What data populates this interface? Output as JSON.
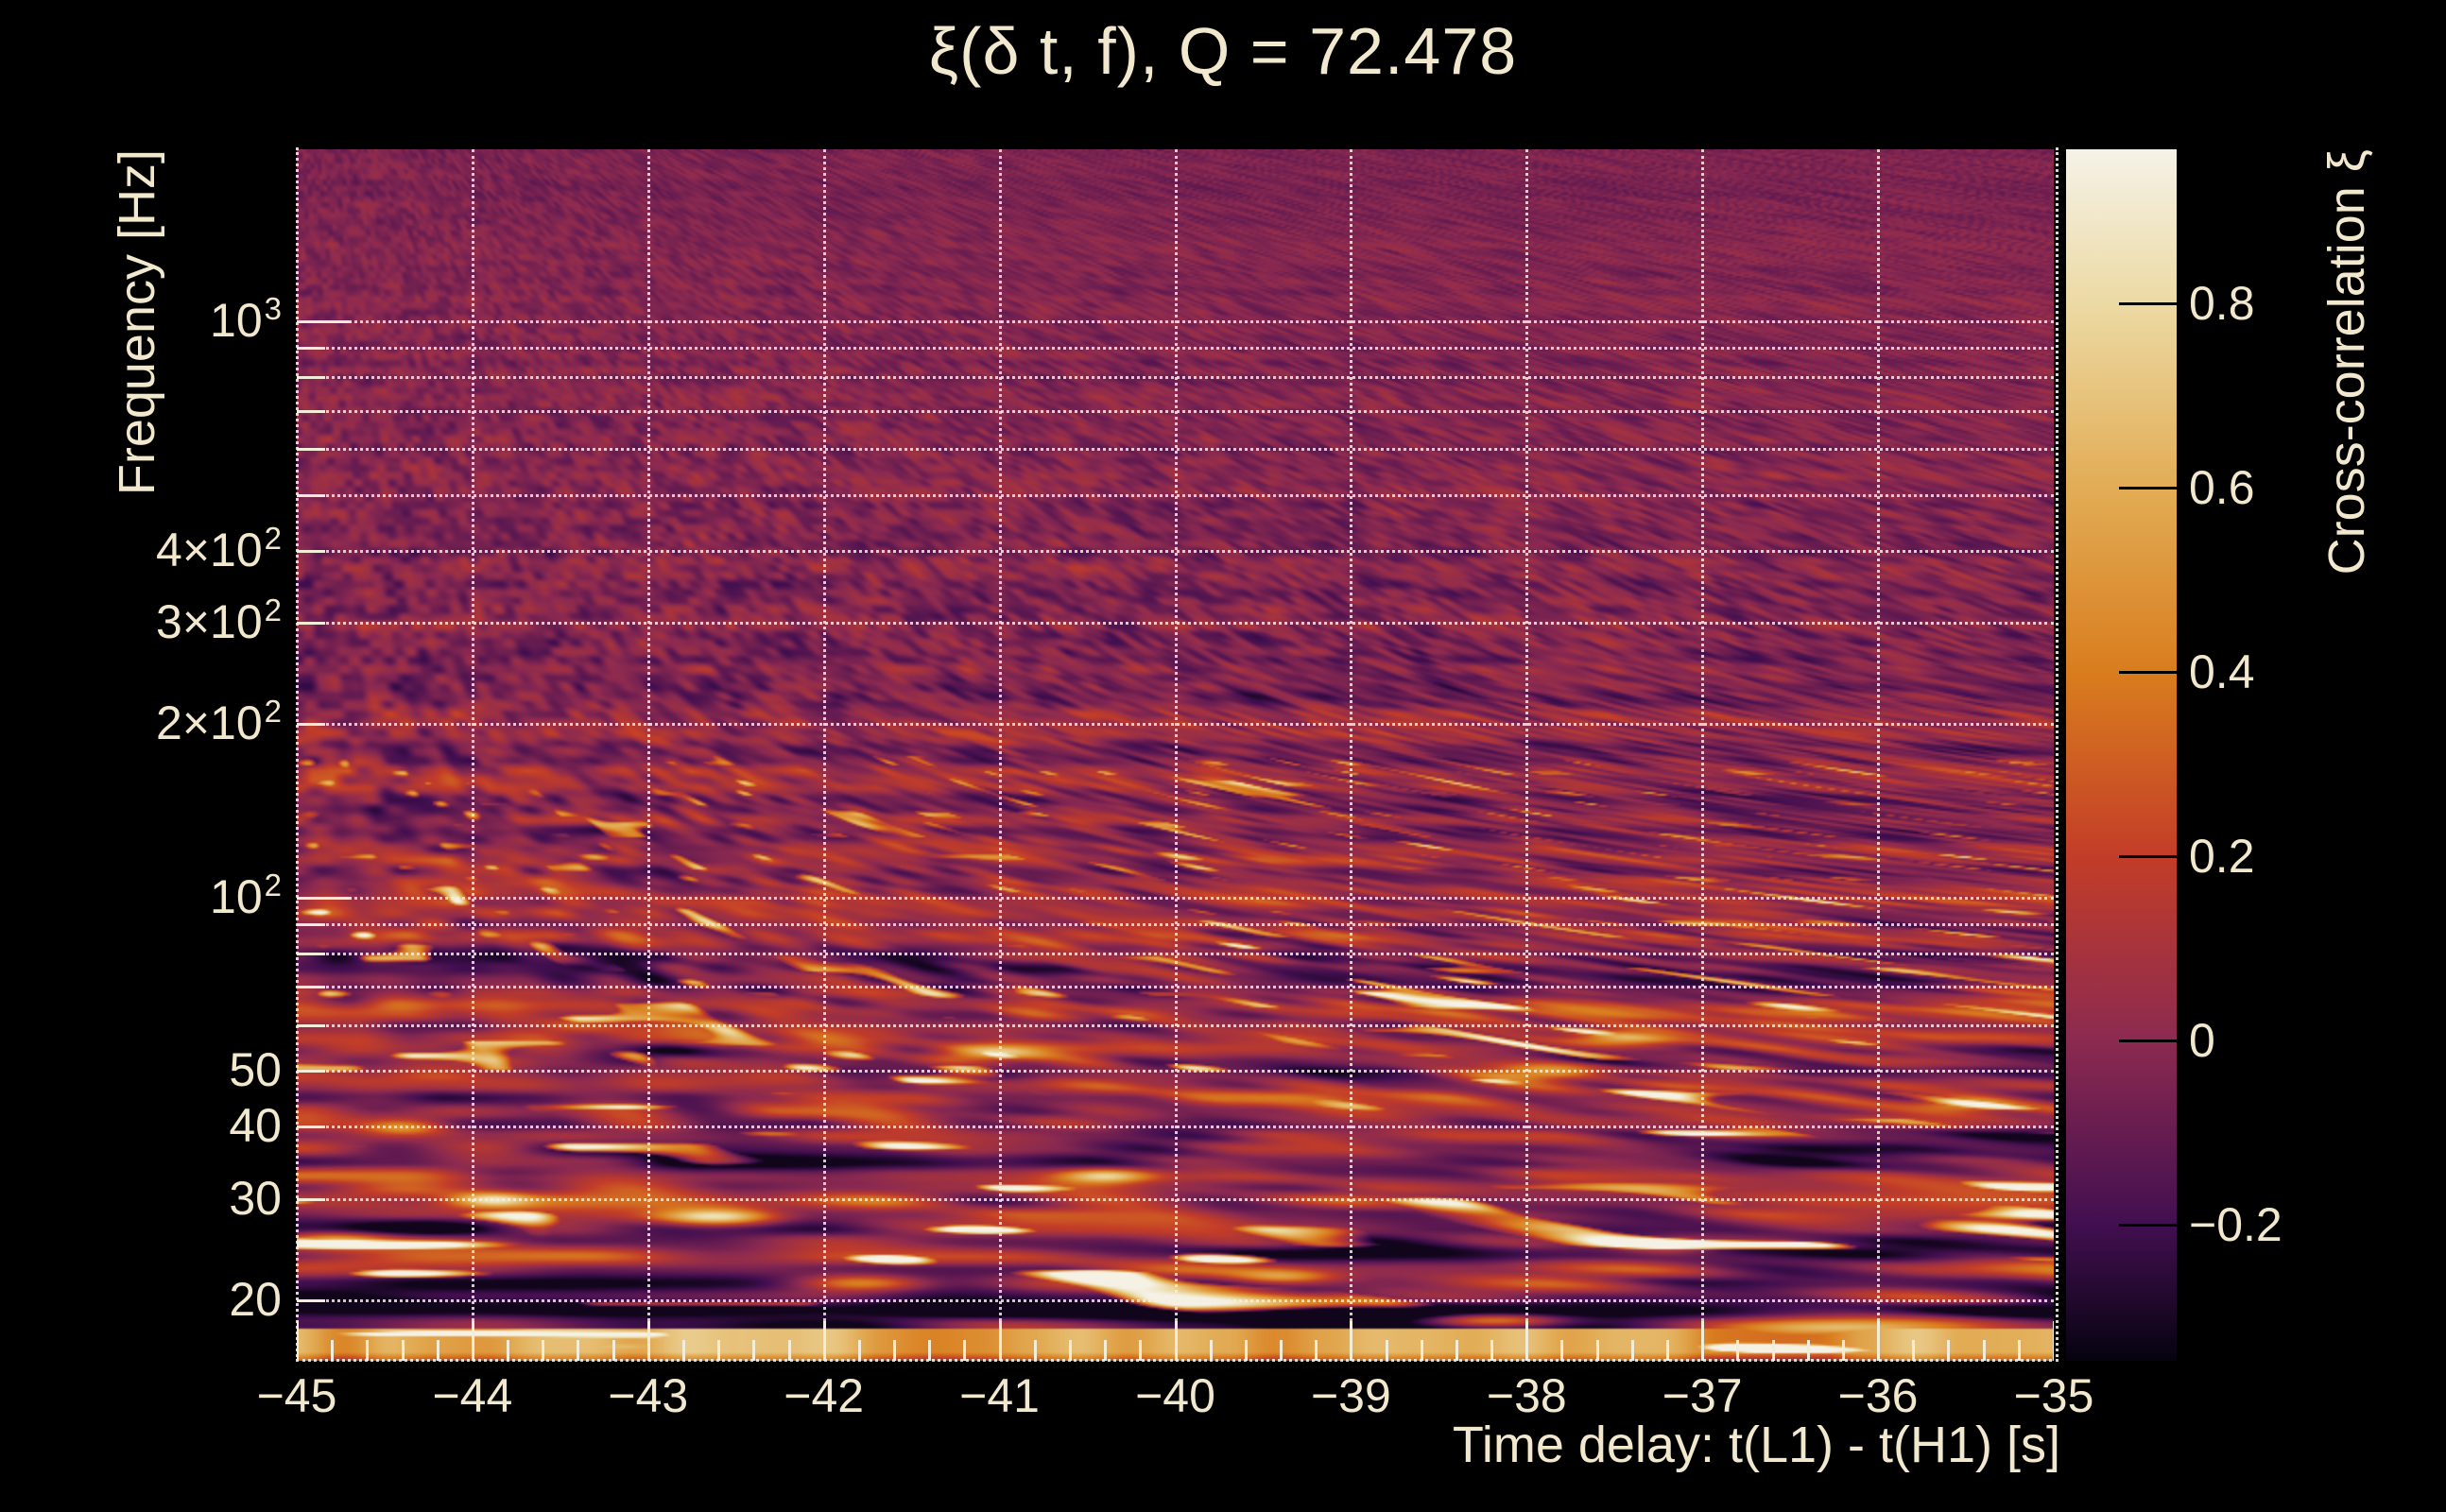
{
  "title": {
    "text": "ξ(δ t, f), Q = 72.478"
  },
  "axes": {
    "x": {
      "title": "Time delay: t(L1) - t(H1) [s]",
      "min": -45,
      "max": -35,
      "ticks": [
        {
          "label": "−45",
          "value": -45
        },
        {
          "label": "−44",
          "value": -44
        },
        {
          "label": "−43",
          "value": -43
        },
        {
          "label": "−42",
          "value": -42
        },
        {
          "label": "−41",
          "value": -41
        },
        {
          "label": "−40",
          "value": -40
        },
        {
          "label": "−39",
          "value": -39
        },
        {
          "label": "−38",
          "value": -38
        },
        {
          "label": "−37",
          "value": -37
        },
        {
          "label": "−36",
          "value": -36
        },
        {
          "label": "−35",
          "value": -35
        }
      ],
      "minor_tick_step": 0.2,
      "grid_values": [
        -44,
        -43,
        -42,
        -41,
        -40,
        -39,
        -38,
        -37,
        -36
      ]
    },
    "y": {
      "title": "Frequency [Hz]",
      "scale": "log",
      "min_hz": 15.7,
      "max_hz": 1990,
      "ticks": [
        {
          "base": "10",
          "sup": "3",
          "value": 1000
        },
        {
          "base": "4×10",
          "sup": "2",
          "value": 400
        },
        {
          "base": "3×10",
          "sup": "2",
          "value": 300
        },
        {
          "base": "2×10",
          "sup": "2",
          "value": 200
        },
        {
          "base": "10",
          "sup": "2",
          "value": 100
        },
        {
          "base": "50",
          "value": 50
        },
        {
          "base": "40",
          "value": 40
        },
        {
          "base": "30",
          "value": 30
        },
        {
          "base": "20",
          "value": 20
        }
      ],
      "grid_values": [
        1000,
        900,
        800,
        700,
        600,
        500,
        400,
        300,
        200,
        100,
        90,
        80,
        70,
        60,
        50,
        40,
        30,
        20
      ],
      "major_tick_values": [
        1000,
        100
      ]
    }
  },
  "colorbar": {
    "title": "Cross-correlation ξ",
    "vmin": -0.348,
    "vmax": 0.967,
    "ticks": [
      {
        "label": "0.8",
        "value": 0.8
      },
      {
        "label": "0.6",
        "value": 0.6
      },
      {
        "label": "0.4",
        "value": 0.4
      },
      {
        "label": "0.2",
        "value": 0.2
      },
      {
        "label": "0",
        "value": 0
      },
      {
        "label": "−0.2",
        "value": -0.2
      }
    ]
  },
  "colors": {
    "background": "#000000",
    "text": "#f2e8cd",
    "grid": "#f4eee0",
    "tick_mark": "#f3ecd8",
    "colorbar_tick": "#000000",
    "colormap_stops": [
      [
        0.0,
        "#060310"
      ],
      [
        0.113,
        "#420f50"
      ],
      [
        0.265,
        "#8c2a50"
      ],
      [
        0.417,
        "#c33d28"
      ],
      [
        0.568,
        "#d97d1e"
      ],
      [
        0.72,
        "#e2ac55"
      ],
      [
        0.873,
        "#ecdaa4"
      ],
      [
        1.0,
        "#f5f2e8"
      ]
    ]
  },
  "chart_data": {
    "type": "heatmap",
    "title": "ξ(δ t, f), Q = 72.478",
    "q_value": 72.478,
    "xlabel": "Time delay: t(L1) - t(H1) [s]",
    "ylabel": "Frequency [Hz]",
    "colorbar_label": "Cross-correlation ξ",
    "x_range_s": [
      -45,
      -35
    ],
    "y_range_hz": [
      15.7,
      1990
    ],
    "y_scale": "log",
    "color_scale_range": [
      -0.348,
      0.967
    ],
    "x_tick_values": [
      -45,
      -44,
      -43,
      -42,
      -41,
      -40,
      -39,
      -38,
      -37,
      -36,
      -35
    ],
    "y_tick_values": [
      1000,
      400,
      300,
      200,
      100,
      50,
      40,
      30,
      20
    ],
    "colorbar_tick_values": [
      0.8,
      0.6,
      0.4,
      0.2,
      0,
      -0.2
    ],
    "grid": "white dotted gridlines at 1 s intervals and at log-decade frequency steps",
    "legend_position": "right colorbar",
    "description": "Noisy cross-correlation Q-transform map: fine low-amplitude maroon mottling above ~200 Hz, horizontally elongated orange streaks below ~100 Hz growing longer toward low frequency, scattered near-white bursts between 16 and 60 Hz, and a continuous bright orange-yellow band near 16-18 Hz along the bottom.",
    "bright_features": [
      {
        "t": -44.8,
        "f": 25.5,
        "amp": 0.5,
        "rx": 60,
        "ry": 9
      },
      {
        "t": -44.4,
        "f": 40.0,
        "amp": 0.38,
        "rx": 45,
        "ry": 8
      },
      {
        "t": -43.9,
        "f": 30.0,
        "amp": 0.45,
        "rx": 40,
        "ry": 8
      },
      {
        "t": -43.3,
        "f": 16.8,
        "amp": 0.45,
        "rx": 110,
        "ry": 8
      },
      {
        "t": -42.6,
        "f": 28.0,
        "amp": 0.62,
        "rx": 60,
        "ry": 9
      },
      {
        "t": -41.9,
        "f": 16.9,
        "amp": 0.55,
        "rx": 95,
        "ry": 8
      },
      {
        "t": -41.8,
        "f": 21.5,
        "amp": 0.5,
        "rx": 70,
        "ry": 9
      },
      {
        "t": -41.0,
        "f": 54.0,
        "amp": 0.45,
        "rx": 55,
        "ry": 8
      },
      {
        "t": -40.4,
        "f": 33.0,
        "amp": 0.55,
        "rx": 48,
        "ry": 8
      },
      {
        "t": -39.4,
        "f": 22.0,
        "amp": 0.4,
        "rx": 55,
        "ry": 8
      },
      {
        "t": -38.2,
        "f": 18.5,
        "amp": 0.65,
        "rx": 80,
        "ry": 8
      },
      {
        "t": -37.9,
        "f": 50.0,
        "amp": 0.6,
        "rx": 70,
        "ry": 9
      },
      {
        "t": -37.5,
        "f": 57.0,
        "amp": 0.4,
        "rx": 50,
        "ry": 8
      },
      {
        "t": -37.2,
        "f": 25.0,
        "amp": 0.45,
        "rx": 50,
        "ry": 8
      },
      {
        "t": -36.2,
        "f": 18.0,
        "amp": 0.5,
        "rx": 150,
        "ry": 10
      },
      {
        "t": -35.5,
        "f": 44.0,
        "amp": 0.4,
        "rx": 50,
        "ry": 8
      }
    ]
  }
}
